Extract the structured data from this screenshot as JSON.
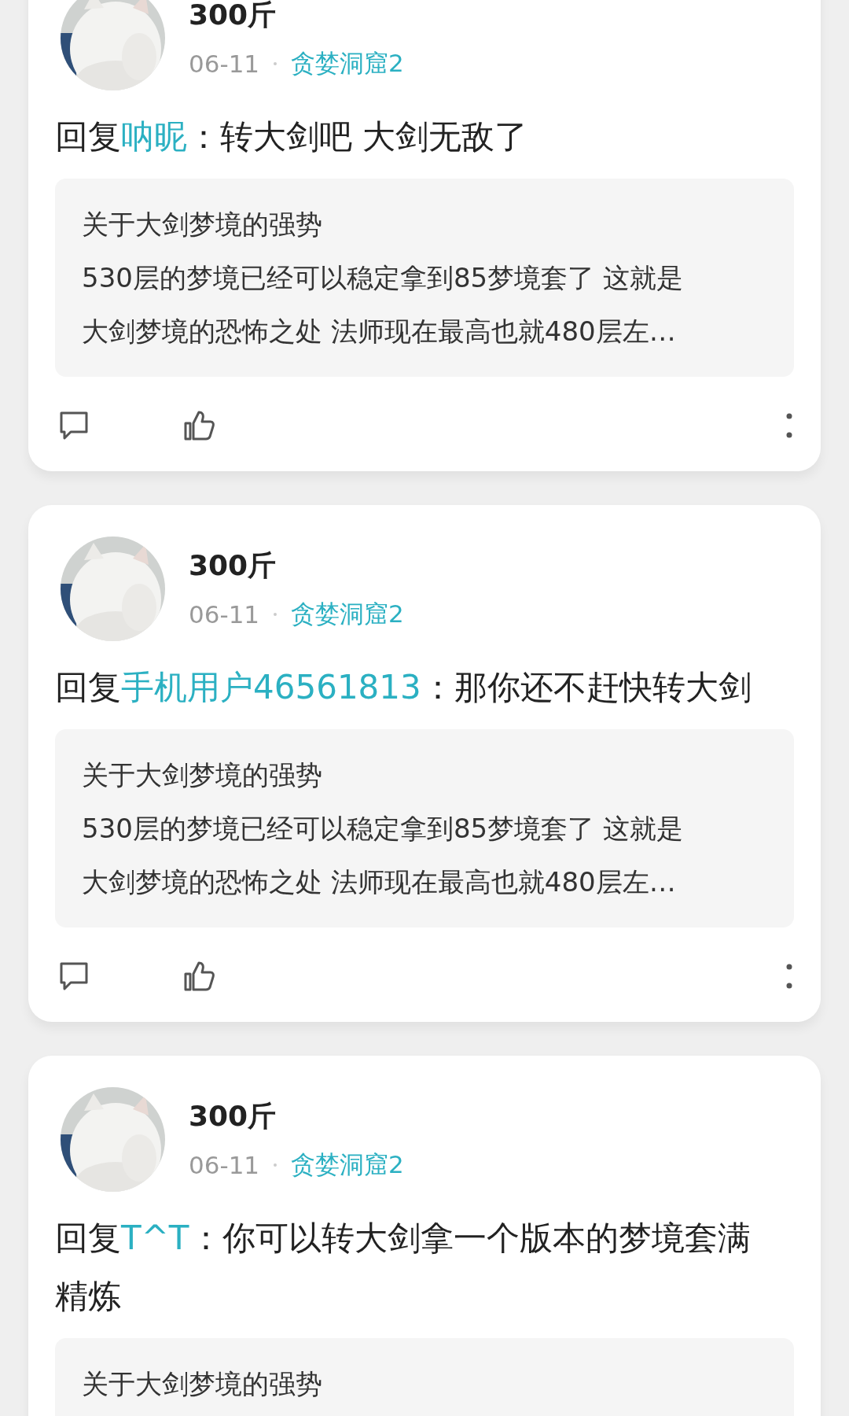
{
  "posts": [
    {
      "author": "300斤",
      "date": "06-11",
      "forum": "贪婪洞窟2",
      "reply_prefix": "回复",
      "reply_to": "呐昵",
      "reply_text": "：转大剑吧 大剑无敌了",
      "quote": {
        "title": "关于大剑梦境的强势",
        "lines": [
          "530层的梦境已经可以稳定拿到85梦境套了 这就是",
          "大剑梦境的恐怖之处 法师现在最高也就480层左…"
        ]
      }
    },
    {
      "author": "300斤",
      "date": "06-11",
      "forum": "贪婪洞窟2",
      "reply_prefix": "回复",
      "reply_to": "手机用户46561813",
      "reply_text": "：那你还不赶快转大剑",
      "quote": {
        "title": "关于大剑梦境的强势",
        "lines": [
          "530层的梦境已经可以稳定拿到85梦境套了 这就是",
          "大剑梦境的恐怖之处 法师现在最高也就480层左…"
        ]
      }
    },
    {
      "author": "300斤",
      "date": "06-11",
      "forum": "贪婪洞窟2",
      "reply_prefix": "回复",
      "reply_to": "T^T",
      "reply_text": "：你可以转大剑拿一个版本的梦境套满精炼",
      "quote": {
        "title": "关于大剑梦境的强势"
      }
    }
  ]
}
